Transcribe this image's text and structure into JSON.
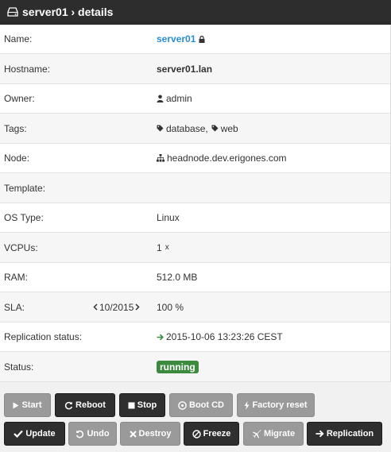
{
  "header": {
    "title": "server01 › details"
  },
  "details": {
    "name": {
      "label": "Name:",
      "value": "server01"
    },
    "hostname": {
      "label": "Hostname:",
      "value": "server01.lan"
    },
    "owner": {
      "label": "Owner:",
      "value": "admin"
    },
    "tags": {
      "label": "Tags:",
      "tag1": "database,",
      "tag2": "web"
    },
    "node": {
      "label": "Node:",
      "value": "headnode.dev.erigones.com"
    },
    "template": {
      "label": "Template:",
      "value": ""
    },
    "ostype": {
      "label": "OS Type:",
      "value": "Linux"
    },
    "vcpus": {
      "label": "VCPUs:",
      "value": "1",
      "unit": "x"
    },
    "ram": {
      "label": "RAM:",
      "value": "512.0 MB"
    },
    "sla": {
      "label": "SLA:",
      "period": "10/2015",
      "value": "100 %"
    },
    "replication": {
      "label": "Replication status:",
      "value": "2015-10-06 13:23:26 CEST"
    },
    "status": {
      "label": "Status:",
      "value": "running"
    }
  },
  "actions": {
    "start": "Start",
    "reboot": "Reboot",
    "stop": "Stop",
    "bootcd": "Boot CD",
    "factory_reset": "Factory reset",
    "update": "Update",
    "undo": "Undo",
    "destroy": "Destroy",
    "freeze": "Freeze",
    "migrate": "Migrate",
    "replication": "Replication"
  },
  "colors": {
    "header_bg": "#2d2d2d",
    "link": "#2a8dd4",
    "status_badge": "#3b8a3e",
    "replication_arrow": "#3b8a3e",
    "button_dark": "#2f2f2f",
    "button_disabled": "#9a9a9a"
  },
  "icons": {
    "header": "hdd-icon",
    "name": "lock-icon",
    "owner": "user-icon",
    "tags": "tag-icon",
    "node": "sitemap-icon",
    "replication": "arrow-right-icon"
  }
}
